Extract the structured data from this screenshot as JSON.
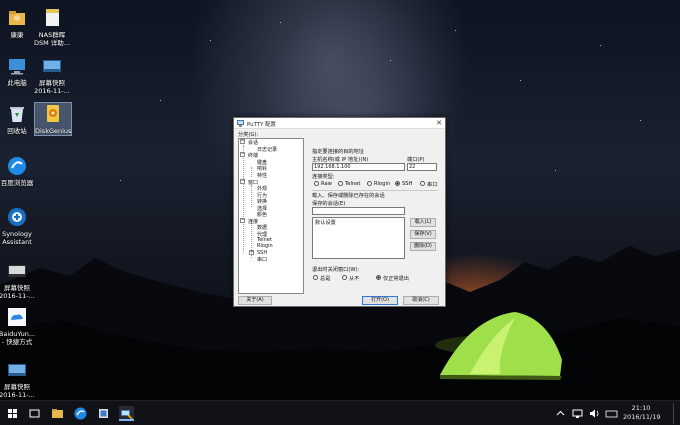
{
  "desktop": {
    "icons": [
      {
        "label": "康康",
        "icon": "user-folder-icon"
      },
      {
        "label": "NAS群晖\nDSM 详助...",
        "icon": "document-icon"
      },
      {
        "label": "此电脑",
        "icon": "computer-icon"
      },
      {
        "label": "屏幕快照\n2016-11-...",
        "icon": "screenshot-icon"
      },
      {
        "label": "回收站",
        "icon": "recycle-bin-icon"
      },
      {
        "label": "DiskGenius",
        "icon": "diskgenius-icon"
      },
      {
        "label": "百度浏览器",
        "icon": "baidu-browser-icon"
      },
      {
        "label": "Synology\nAssistant",
        "icon": "synology-icon"
      },
      {
        "label": "屏幕快照\n2016-11-...",
        "icon": "screenshot-icon"
      },
      {
        "label": "BaiduYun...\n- 快捷方式",
        "icon": "baiduyun-icon"
      },
      {
        "label": "屏幕快照\n2016-11-...",
        "icon": "screenshot-icon"
      }
    ]
  },
  "putty": {
    "title": "PuTTY 配置",
    "category_label": "分类(G):",
    "tree": [
      {
        "label": "会话",
        "level": 0,
        "expander": "−"
      },
      {
        "label": "日志记录",
        "level": 1
      },
      {
        "label": "终端",
        "level": 0,
        "expander": "−"
      },
      {
        "label": "键盘",
        "level": 1
      },
      {
        "label": "响铃",
        "level": 1
      },
      {
        "label": "特性",
        "level": 1
      },
      {
        "label": "窗口",
        "level": 0,
        "expander": "−"
      },
      {
        "label": "外观",
        "level": 1
      },
      {
        "label": "行为",
        "level": 1
      },
      {
        "label": "转换",
        "level": 1
      },
      {
        "label": "选择",
        "level": 1
      },
      {
        "label": "颜色",
        "level": 1
      },
      {
        "label": "连接",
        "level": 0,
        "expander": "−"
      },
      {
        "label": "数据",
        "level": 1
      },
      {
        "label": "代理",
        "level": 1
      },
      {
        "label": "Telnet",
        "level": 1
      },
      {
        "label": "Rlogin",
        "level": 1
      },
      {
        "label": "SSH",
        "level": 1,
        "expander": "+"
      },
      {
        "label": "串口",
        "level": 1
      }
    ],
    "section_title": "指定要连接的目的地址",
    "host_label": "主机名称(或 IP 地址)(N)",
    "port_label": "端口(P)",
    "host_value": "192.168.1.100",
    "port_value": "22",
    "conn_type_label": "连接类型:",
    "conn_types": [
      "Raw",
      "Telnet",
      "Rlogin",
      "SSH",
      "串口"
    ],
    "conn_type_selected": "SSH",
    "session_section": "载入、保存或删除已存在的会话",
    "saved_sessions_label": "保存的会话(E)",
    "saved_sessions_input": "",
    "sessions": [
      "默认设置"
    ],
    "load_button": "载入(L)",
    "save_button": "保存(V)",
    "delete_button": "删除(D)",
    "close_exit_label": "退出时关闭窗口(W):",
    "close_exit_options": [
      "总是",
      "从不",
      "仅正常退出"
    ],
    "close_exit_selected": "仅正常退出",
    "about_button": "关于(A)",
    "open_button": "打开(O)",
    "cancel_button": "取消(C)"
  },
  "taskbar": {
    "time": "21:10",
    "date": "2016/11/19"
  }
}
